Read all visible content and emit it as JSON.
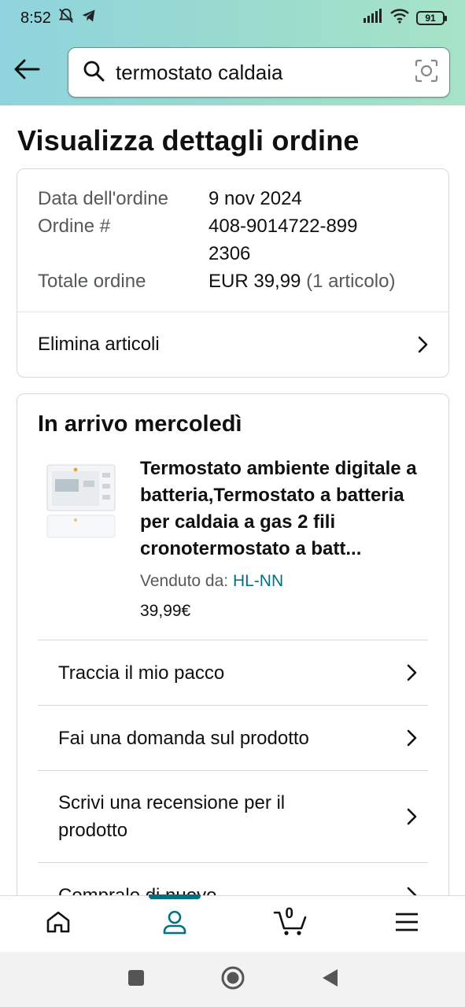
{
  "status_bar": {
    "time": "8:52",
    "battery": "91"
  },
  "search": {
    "query": "termostato caldaia"
  },
  "page": {
    "title": "Visualizza dettagli ordine"
  },
  "order": {
    "rows": [
      {
        "label": "Data dell'ordine",
        "value": "9 nov 2024"
      },
      {
        "label": "Ordine #",
        "value": "408-9014722-8992306"
      }
    ],
    "total_label": "Totale ordine",
    "total_value": "EUR 39,99",
    "total_items": "(1 articolo)",
    "remove_items_label": "Elimina articoli"
  },
  "shipment": {
    "title": "In arrivo mercoledì",
    "product": {
      "name": "Termostato ambiente digitale a batteria,Termostato a batteria per caldaia a gas 2 fili cronotermostato a batt...",
      "seller_label": "Venduto da:",
      "seller_name": "HL-NN",
      "price": "39,99€"
    },
    "actions": [
      "Traccia il mio pacco",
      "Fai una domanda sul prodotto",
      "Scrivi una recensione per il prodotto",
      "Compralo di nuovo"
    ]
  },
  "bottom_nav": {
    "cart_count": "0"
  },
  "icons": [
    "back-arrow-icon",
    "search-icon",
    "camera-lens-icon",
    "chevron-right-icon",
    "home-icon",
    "account-icon",
    "cart-icon",
    "menu-icon"
  ],
  "colors": {
    "accent": "#007185",
    "header_gradient_start": "#8fd3de",
    "header_gradient_end": "#a6e3c8"
  }
}
